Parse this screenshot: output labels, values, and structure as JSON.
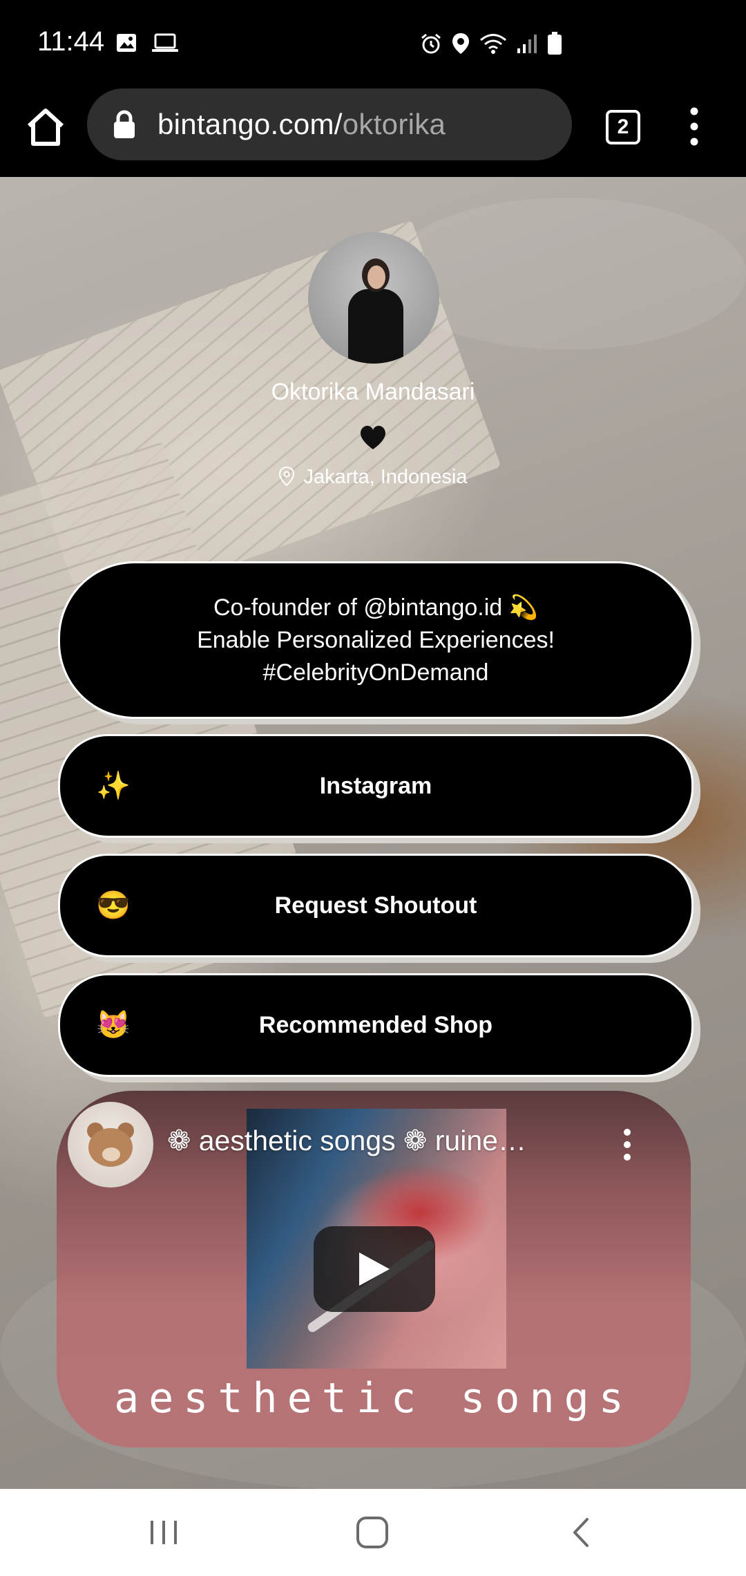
{
  "status_bar": {
    "time": "11:44",
    "left_icons": [
      "image-icon",
      "laptop-icon"
    ],
    "right_icons": [
      "alarm-icon",
      "location-icon",
      "wifi-icon",
      "signal-icon",
      "battery-icon"
    ]
  },
  "browser": {
    "url_domain": "bintango.com/",
    "url_path": "oktorika",
    "tab_count": "2"
  },
  "profile": {
    "name": "Oktorika Mandasari",
    "location": "Jakarta, Indonesia",
    "bio_lines": [
      "Co-founder of @bintango.id 💫",
      "Enable Personalized Experiences!",
      "#CelebrityOnDemand"
    ]
  },
  "links": [
    {
      "emoji": "✨",
      "label": "Instagram"
    },
    {
      "emoji": "😎",
      "label": "Request Shoutout"
    },
    {
      "emoji": "😻",
      "label": "Recommended Shop"
    }
  ],
  "video": {
    "title": "❁ aesthetic songs ❁ ruine…",
    "caption": "aesthetic songs"
  },
  "colors": {
    "button_bg": "#000000",
    "video_bg": "#b67477"
  }
}
